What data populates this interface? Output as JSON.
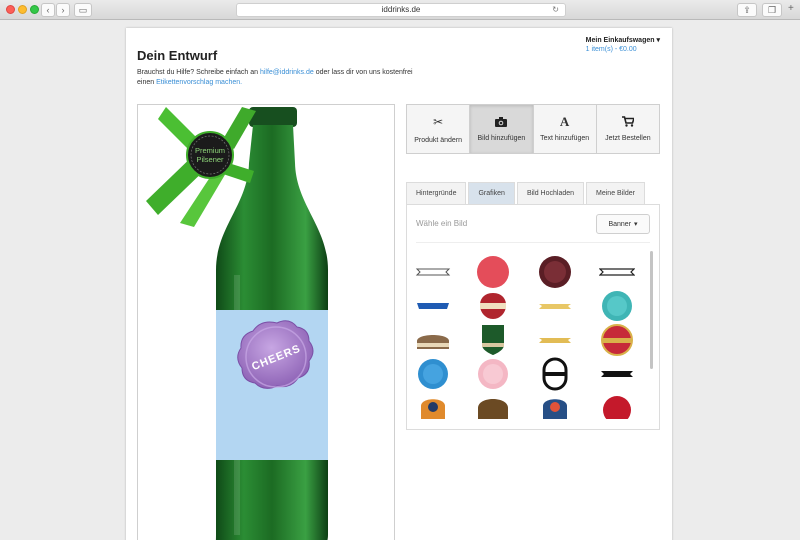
{
  "browser": {
    "url": "iddrinks.de"
  },
  "header": {
    "title": "Dein Entwurf",
    "help_prefix": "Brauchst du Hilfe? Schreibe einfach an ",
    "help_email": "hilfe@iddrinks.de",
    "help_middle": " oder lass dir von uns kostenfrei einen ",
    "help_link": "Etikettenvorschlag machen.",
    "cart_label": "Mein Einkaufswagen",
    "cart_items": "1 item(s) - €0.00"
  },
  "design": {
    "ribbon_text_1": "Premium",
    "ribbon_text_2": "Pilsener",
    "label_text": "CHEERS"
  },
  "tools": [
    {
      "label": "Produkt ändern",
      "icon": "scissors-icon"
    },
    {
      "label": "Bild hinzufügen",
      "icon": "camera-icon"
    },
    {
      "label": "Text hinzufügen",
      "icon": "text-icon"
    },
    {
      "label": "Jetzt Bestellen",
      "icon": "cart-icon"
    }
  ],
  "tabs": [
    "Hintergründe",
    "Grafiken",
    "Bild Hochladen",
    "Meine Bilder"
  ],
  "active_tab": "Grafiken",
  "picker": {
    "placeholder": "Wähle ein Bild",
    "category": "Banner"
  },
  "colors": {
    "bottle": "#1f7a2b",
    "label": "#b3d6f2",
    "seal": "#a57cc8",
    "ribbon": "#3fae2b",
    "link": "#3a8fd6"
  }
}
